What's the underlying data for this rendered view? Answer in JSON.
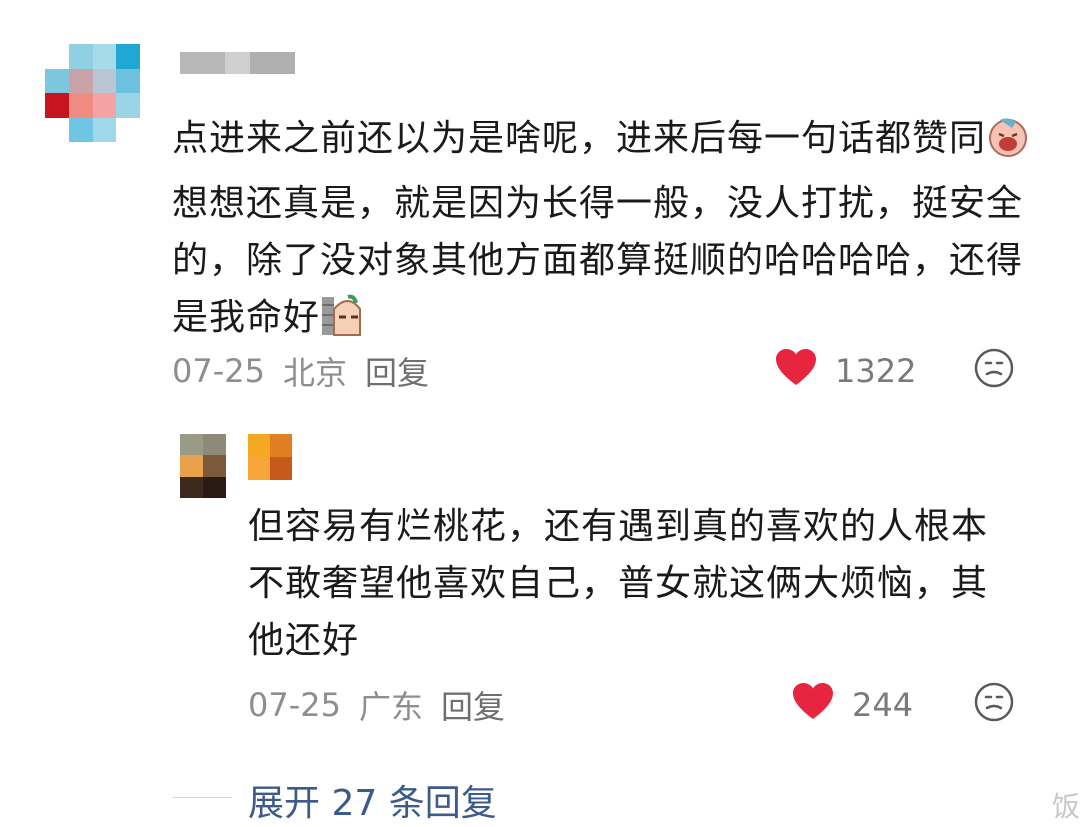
{
  "comment": {
    "text_part1": "点进来之前还以为是啥呢，进来后每一句话都赞同",
    "text_part2": "想想还真是，就是因为长得一般，没人打扰，挺安全的，除了没对象其他方面都算挺顺的哈哈哈哈，还得是我命好",
    "date": "07-25",
    "location": "北京",
    "reply_label": "回复",
    "like_count": "1322"
  },
  "reply": {
    "text": "但容易有烂桃花，还有遇到真的喜欢的人根本不敢奢望他喜欢自己，普女就这俩大烦恼，其他还好",
    "date": "07-25",
    "location": "广东",
    "reply_label": "回复",
    "like_count": "244"
  },
  "expand_label": "展开 27 条回复",
  "watermark": "饭",
  "colors": {
    "heart": "#e8253f",
    "link": "#3d5a8c",
    "meta": "#8e8e8e"
  },
  "icons": [
    "heart-icon",
    "emoji-reaction-icon",
    "crying-face-emoji",
    "peeking-face-emoji"
  ]
}
